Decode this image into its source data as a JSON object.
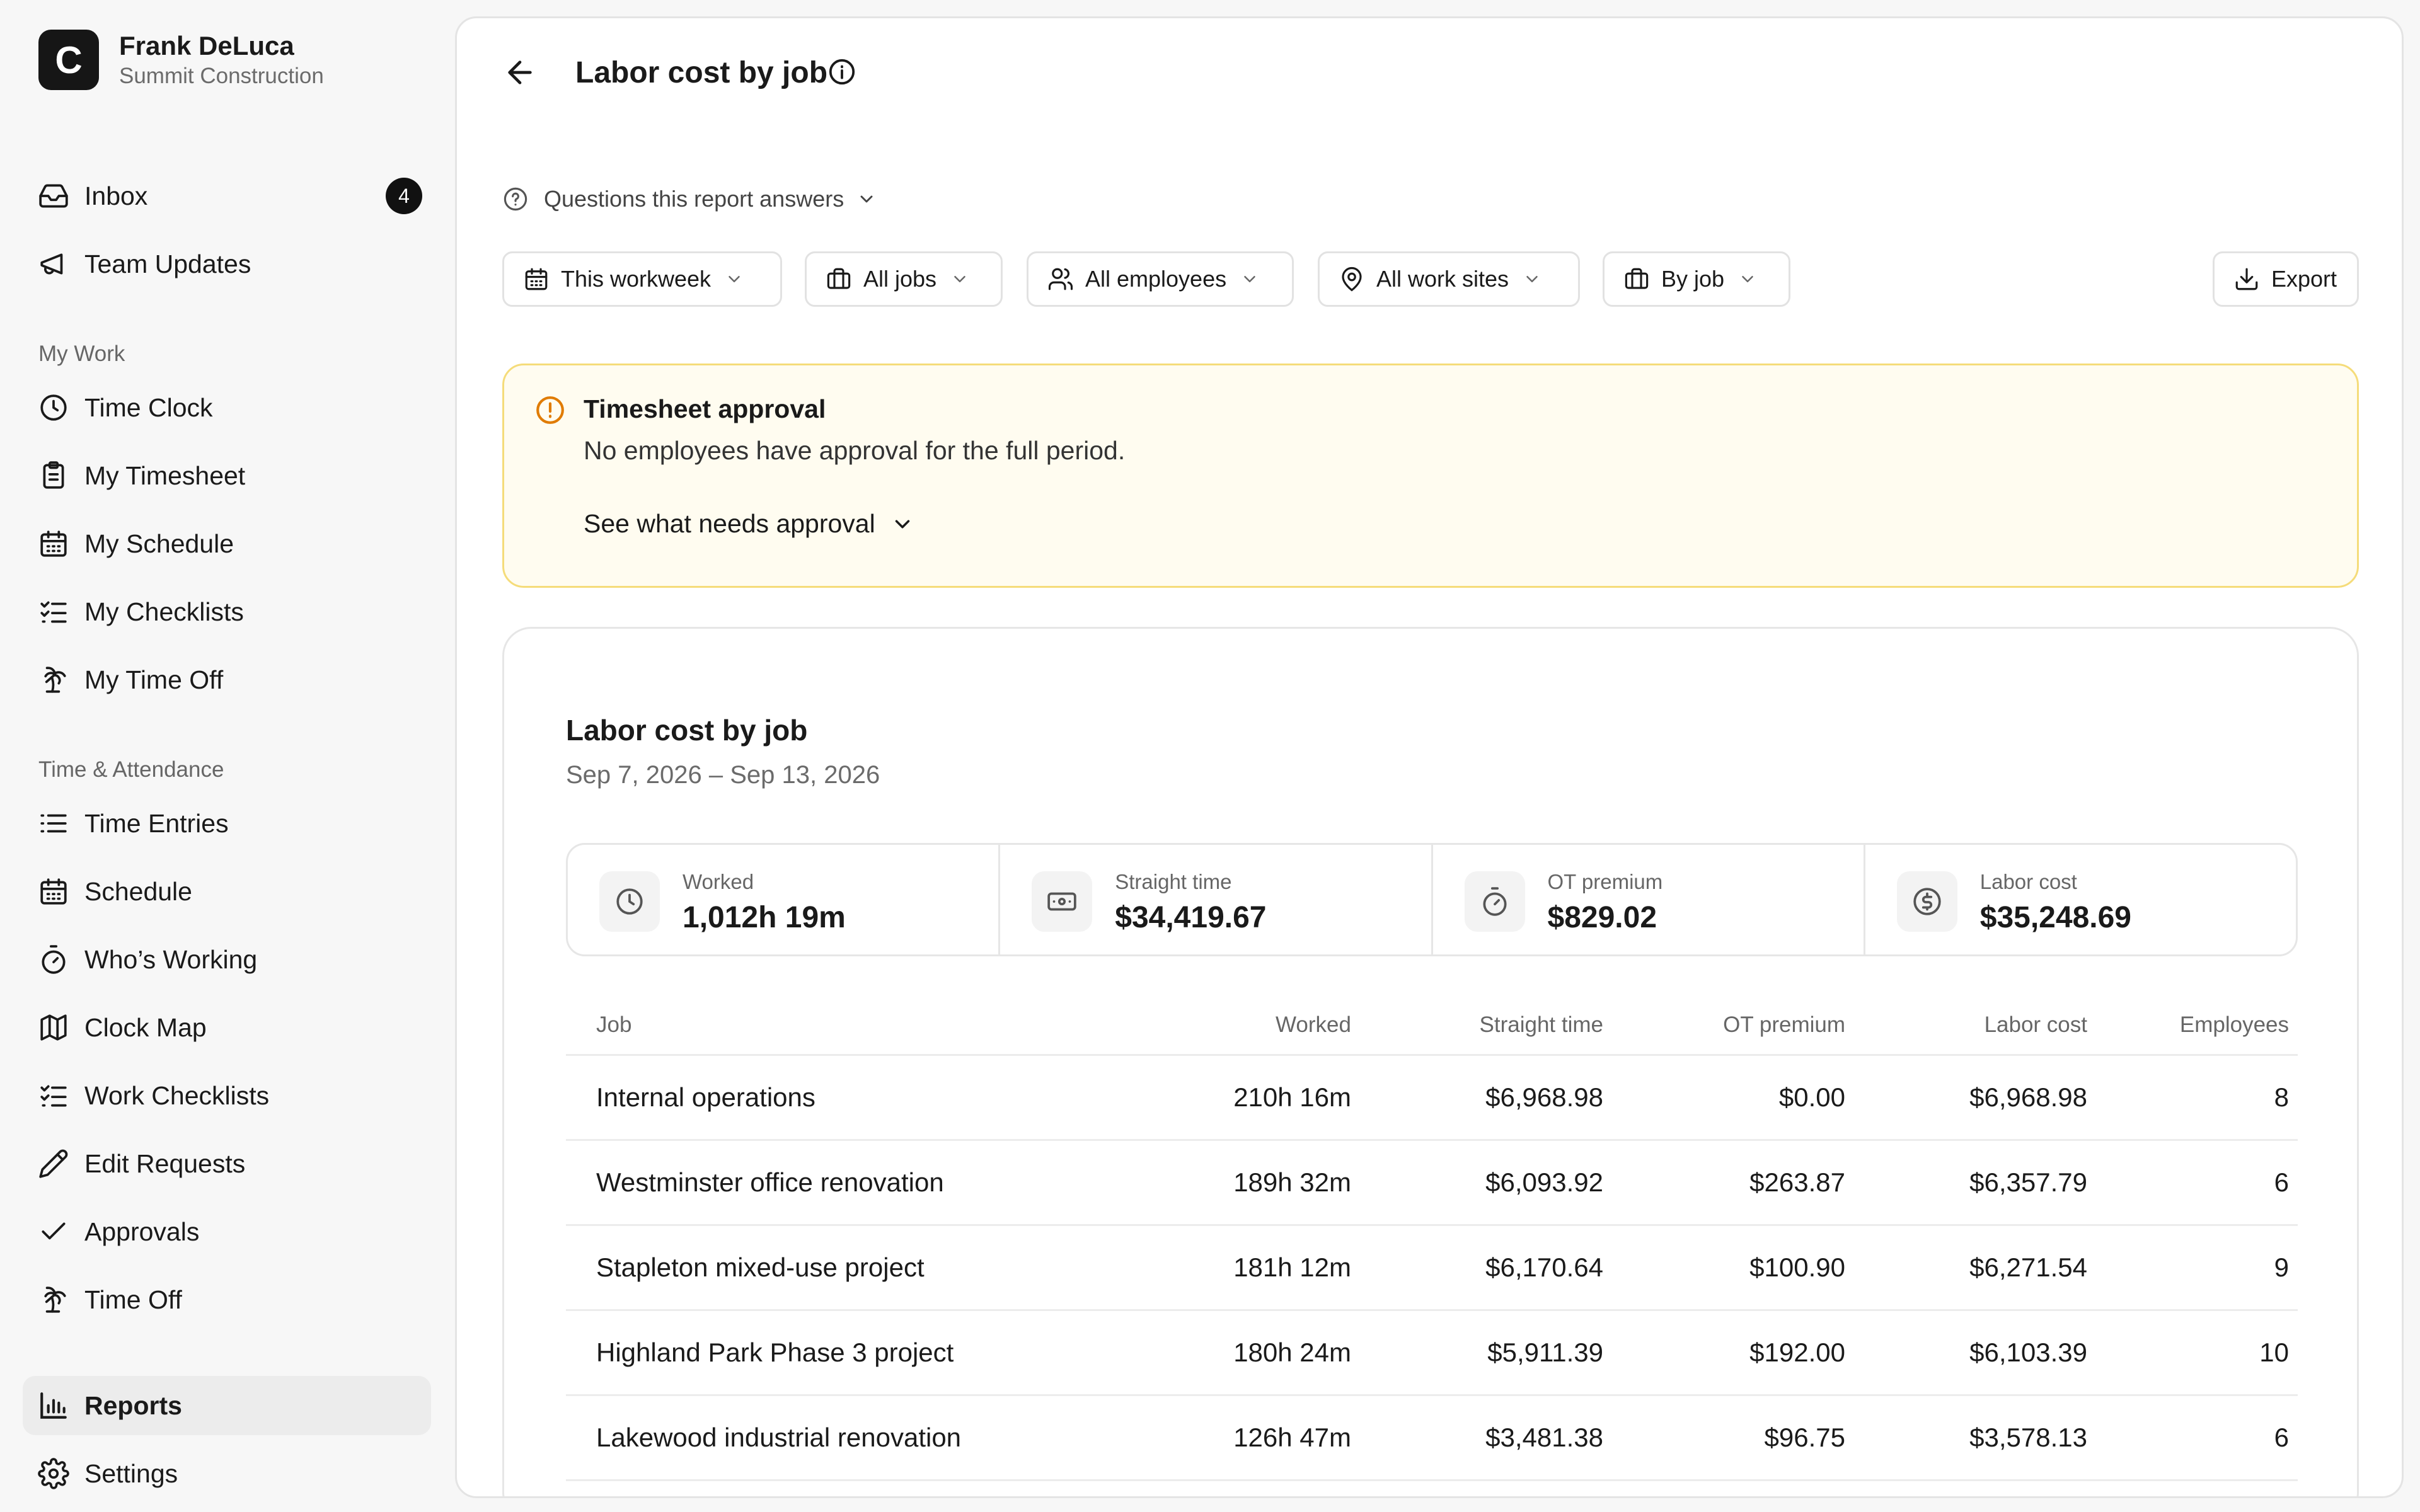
{
  "account": {
    "initial": "C",
    "name": "Frank DeLuca",
    "org": "Summit Construction"
  },
  "sidebar": {
    "top": [
      {
        "label": "Inbox",
        "icon": "inbox-icon",
        "badge": "4"
      },
      {
        "label": "Team Updates",
        "icon": "megaphone-icon"
      }
    ],
    "my_work": {
      "heading": "My Work",
      "items": [
        {
          "label": "Time Clock",
          "icon": "clock-icon"
        },
        {
          "label": "My Timesheet",
          "icon": "clipboard-icon"
        },
        {
          "label": "My Schedule",
          "icon": "calendar-icon"
        },
        {
          "label": "My Checklists",
          "icon": "checklist-icon"
        },
        {
          "label": "My Time Off",
          "icon": "palm-tree-icon"
        }
      ]
    },
    "time_attendance": {
      "heading": "Time & Attendance",
      "items": [
        {
          "label": "Time Entries",
          "icon": "list-icon"
        },
        {
          "label": "Schedule",
          "icon": "calendar-icon"
        },
        {
          "label": "Who’s Working",
          "icon": "stopwatch-icon"
        },
        {
          "label": "Clock Map",
          "icon": "map-icon"
        },
        {
          "label": "Work Checklists",
          "icon": "checklist-icon"
        },
        {
          "label": "Edit Requests",
          "icon": "pencil-icon"
        },
        {
          "label": "Approvals",
          "icon": "check-icon"
        },
        {
          "label": "Time Off",
          "icon": "palm-tree-icon"
        }
      ]
    },
    "bottom": [
      {
        "label": "Reports",
        "icon": "bar-chart-icon",
        "active": true
      },
      {
        "label": "Settings",
        "icon": "gear-icon"
      }
    ]
  },
  "header": {
    "title": "Labor cost by job"
  },
  "questions_label": "Questions this report answers",
  "filters": {
    "period": "This workweek",
    "jobs": "All jobs",
    "employees": "All employees",
    "sites": "All work sites",
    "group": "By job",
    "export": "Export"
  },
  "alert": {
    "title": "Timesheet approval",
    "body": "No employees have approval for the full period.",
    "link": "See what needs approval"
  },
  "report": {
    "title": "Labor cost by job",
    "range": "Sep 7, 2026 – Sep 13, 2026",
    "kpis": [
      {
        "label": "Worked",
        "value": "1,012h 19m",
        "icon": "clock-icon"
      },
      {
        "label": "Straight time",
        "value": "$34,419.67",
        "icon": "banknote-icon"
      },
      {
        "label": "OT premium",
        "value": "$829.02",
        "icon": "stopwatch-icon"
      },
      {
        "label": "Labor cost",
        "value": "$35,248.69",
        "icon": "dollar-circle-icon"
      }
    ],
    "columns": [
      "Job",
      "Worked",
      "Straight time",
      "OT premium",
      "Labor cost",
      "Employees"
    ],
    "rows": [
      {
        "job": "Internal operations",
        "worked": "210h 16m",
        "straight": "$6,968.98",
        "ot": "$0.00",
        "cost": "$6,968.98",
        "employees": "8"
      },
      {
        "job": "Westminster office renovation",
        "worked": "189h 32m",
        "straight": "$6,093.92",
        "ot": "$263.87",
        "cost": "$6,357.79",
        "employees": "6"
      },
      {
        "job": "Stapleton mixed-use project",
        "worked": "181h 12m",
        "straight": "$6,170.64",
        "ot": "$100.90",
        "cost": "$6,271.54",
        "employees": "9"
      },
      {
        "job": "Highland Park Phase 3 project",
        "worked": "180h 24m",
        "straight": "$5,911.39",
        "ot": "$192.00",
        "cost": "$6,103.39",
        "employees": "10"
      },
      {
        "job": "Lakewood industrial renovation",
        "worked": "126h 47m",
        "straight": "$3,481.38",
        "ot": "$96.75",
        "cost": "$3,578.13",
        "employees": "6"
      }
    ]
  }
}
